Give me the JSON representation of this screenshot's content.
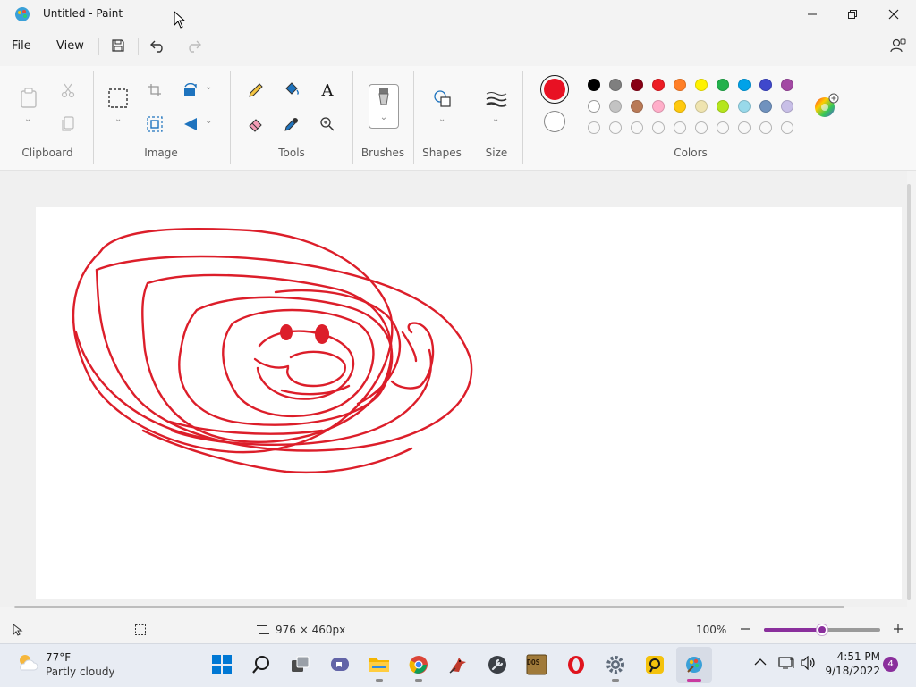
{
  "window": {
    "title": "Untitled - Paint"
  },
  "menu": {
    "file": "File",
    "view": "View"
  },
  "ribbon": {
    "groups": {
      "clipboard": "Clipboard",
      "image": "Image",
      "tools": "Tools",
      "brushes": "Brushes",
      "shapes": "Shapes",
      "size": "Size",
      "colors": "Colors"
    },
    "text_tool_glyph": "A"
  },
  "colors": {
    "primary": "#e81123",
    "secondary": "#ffffff",
    "palette_row1": [
      "#000000",
      "#7f7f7f",
      "#880015",
      "#ed1c24",
      "#ff7f27",
      "#fff200",
      "#22b14c",
      "#00a2e8",
      "#3f48cc",
      "#a349a4"
    ],
    "palette_row2": [
      "#ffffff",
      "#c3c3c3",
      "#b97a57",
      "#ffaec9",
      "#ffc90e",
      "#efe4b0",
      "#b5e61d",
      "#99d9ea",
      "#7092be",
      "#c8bfe7"
    ]
  },
  "statusbar": {
    "canvas_size": "976 × 460px",
    "zoom": "100%",
    "zoom_level": 0.5
  },
  "taskbar": {
    "weather_temp": "77°F",
    "weather_desc": "Partly cloudy",
    "time": "4:51 PM",
    "date": "9/18/2022",
    "notification_count": "4",
    "dosbox_label": "DOS"
  }
}
